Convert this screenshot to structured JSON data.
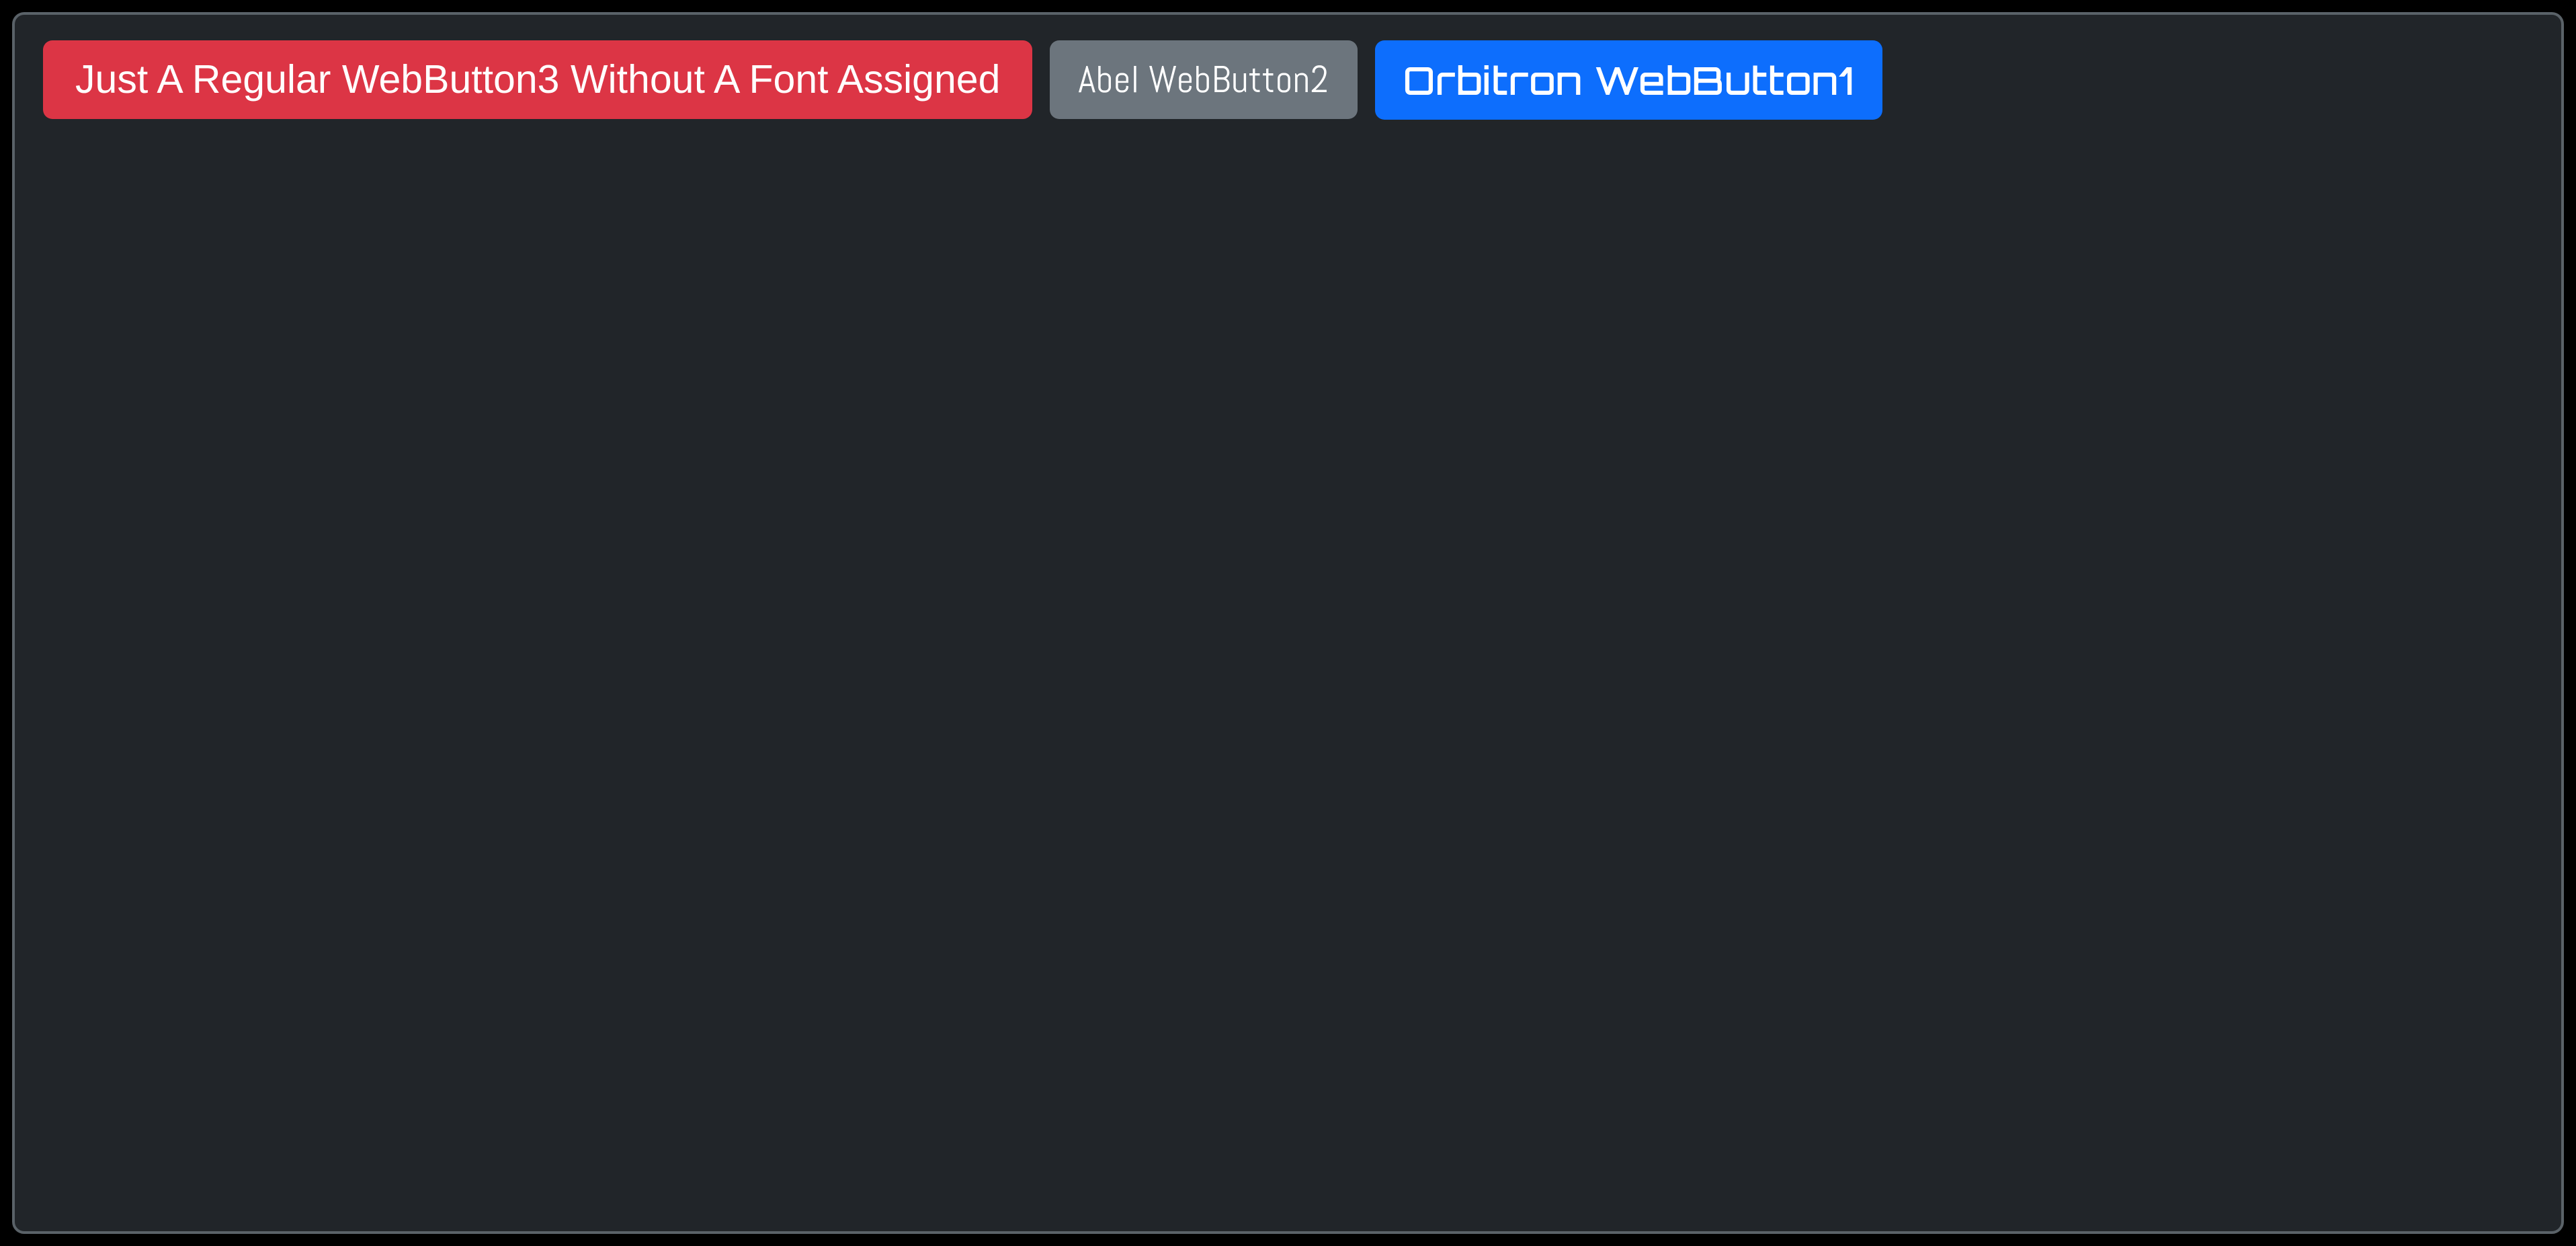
{
  "buttons": {
    "button3": {
      "label": "Just A Regular WebButton3 Without A Font Assigned"
    },
    "button2": {
      "label": "Abel WebButton2"
    },
    "button1": {
      "label": "Orbitron WebButton1"
    }
  },
  "colors": {
    "background": "#212529",
    "border": "#5a6268",
    "red": "#dc3545",
    "gray": "#6c757d",
    "blue": "#0d6efd"
  }
}
